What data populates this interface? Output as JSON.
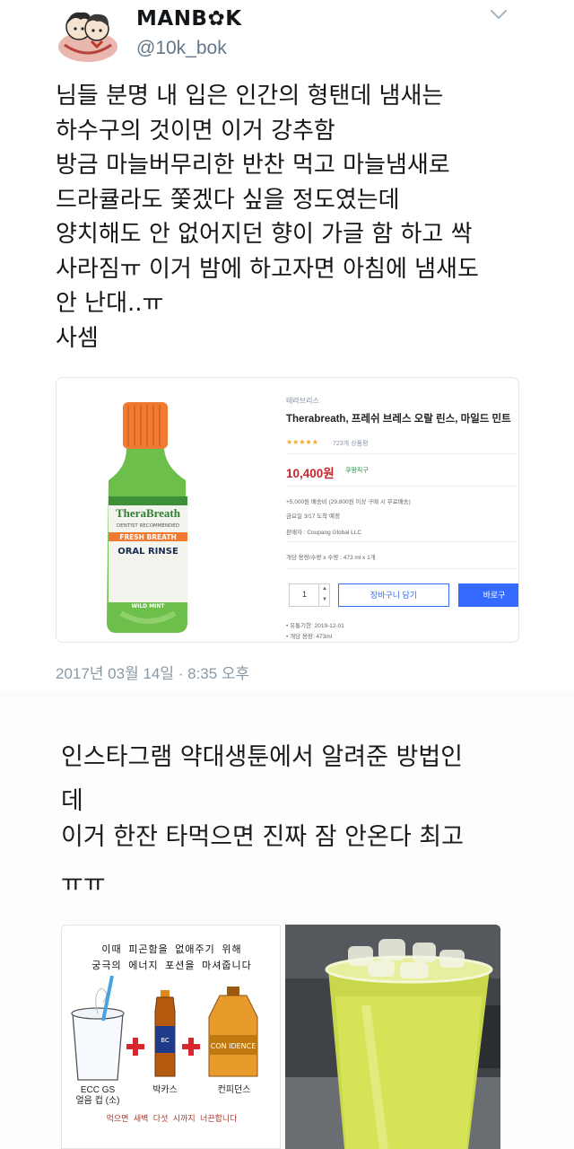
{
  "tweet": {
    "display_name": "MANB✿K",
    "handle": "@10k_bok",
    "body_lines": [
      "님들 분명 내 입은 인간의 형탠데 냄새는",
      "하수구의 것이면 이거 강추함",
      "방금 마늘버무리한 반찬 먹고 마늘냄새로",
      "드라큘라도 쫓겠다 싶을 정도였는데",
      "양치해도 안 없어지던 향이 가글 함 하고 싹",
      "사라짐ㅠ 이거 밤에 하고자면 아침에 냄새도",
      "안 난대..ㅠ",
      "사셈"
    ],
    "timestamp": "2017년 03월 14일 · 8:35 오후",
    "product_card": {
      "bottle_label": {
        "brand": "TheraBreath",
        "recommended": "DENTIST RECOMMENDED",
        "line1": "FRESH BREATH",
        "line2": "ORAL RINSE",
        "flavor": "WILD MINT"
      },
      "brand_small": "테라브리스",
      "title": "Therabreath, 프레쉬 브레스 오랄 린스, 마일드 민트",
      "stars": "★★★★★",
      "reviews": "723개 상품평",
      "price": "10,400원",
      "rocket": "쿠팡직구",
      "shipping": "+5,000원 배송비 (29,800원 이상 구매 시 무료배송)",
      "arrival": "금요일 3/17 도착 예정",
      "seller": "판매자 : Coupang Global LLC",
      "option": "개당 용량/수량 x 수량 : 473 ml x 1개",
      "qty": "1",
      "cart_button": "장바구니 담기",
      "buy_button": "바로구",
      "expiry": "유통기한: 2019-12-01",
      "volume": "개당 용량: 473ml"
    }
  },
  "post2": {
    "lines": [
      "인스타그램 약대생툰에서 알려준 방법인",
      "데",
      "이거 한잔 타먹으면 진짜 잠 안온다 최고",
      "ㅠㅠ"
    ],
    "illustration": {
      "header1": "이때 피곤함을 없애주기 위해",
      "header2": "궁극의 에너지 포션을 마셔줍니다",
      "item1_line1": "ECC GS",
      "item1_line2": "얼음 컵 (소)",
      "item2": "박카스",
      "item3": "컨피던스",
      "item3_label": "CON IDENCE",
      "footer": "먹으면 새벽 다섯 시까지 너끈합니다"
    }
  },
  "colors": {
    "handle": "#657786",
    "timestamp": "#8899a6",
    "price": "#c3272d",
    "coupang_blue": "#346aff",
    "cap_orange": "#f07a32",
    "bottle_green": "#6dbf4b"
  }
}
